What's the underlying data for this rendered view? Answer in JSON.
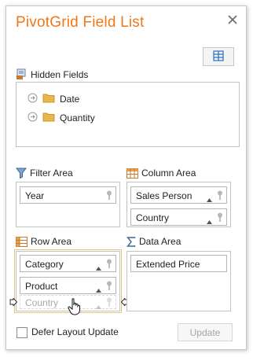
{
  "dialog": {
    "title": "PivotGrid Field List"
  },
  "icons": {
    "close": "close-icon",
    "layout": "layout-grid-icon",
    "hidden_fields": "hidden-fields-icon",
    "filter": "filter-icon",
    "column": "table-column-icon",
    "row": "table-row-icon",
    "data": "sigma-icon"
  },
  "hidden_fields": {
    "label": "Hidden Fields",
    "items": [
      {
        "label": "Date"
      },
      {
        "label": "Quantity"
      }
    ]
  },
  "filter_area": {
    "label": "Filter Area",
    "fields": [
      {
        "label": "Year"
      }
    ]
  },
  "column_area": {
    "label": "Column Area",
    "fields": [
      {
        "label": "Sales Person"
      },
      {
        "label": "Country"
      }
    ]
  },
  "row_area": {
    "label": "Row Area",
    "fields": [
      {
        "label": "Category"
      },
      {
        "label": "Product"
      }
    ],
    "dragging_field": {
      "label": "Country"
    }
  },
  "data_area": {
    "label": "Data Area",
    "fields": [
      {
        "label": "Extended Price"
      }
    ]
  },
  "footer": {
    "defer_label": "Defer Layout Update",
    "update_label": "Update"
  },
  "colors": {
    "title": "#f07818",
    "accent": "#e6c67a",
    "icon_blue": "#2b6fbf"
  }
}
